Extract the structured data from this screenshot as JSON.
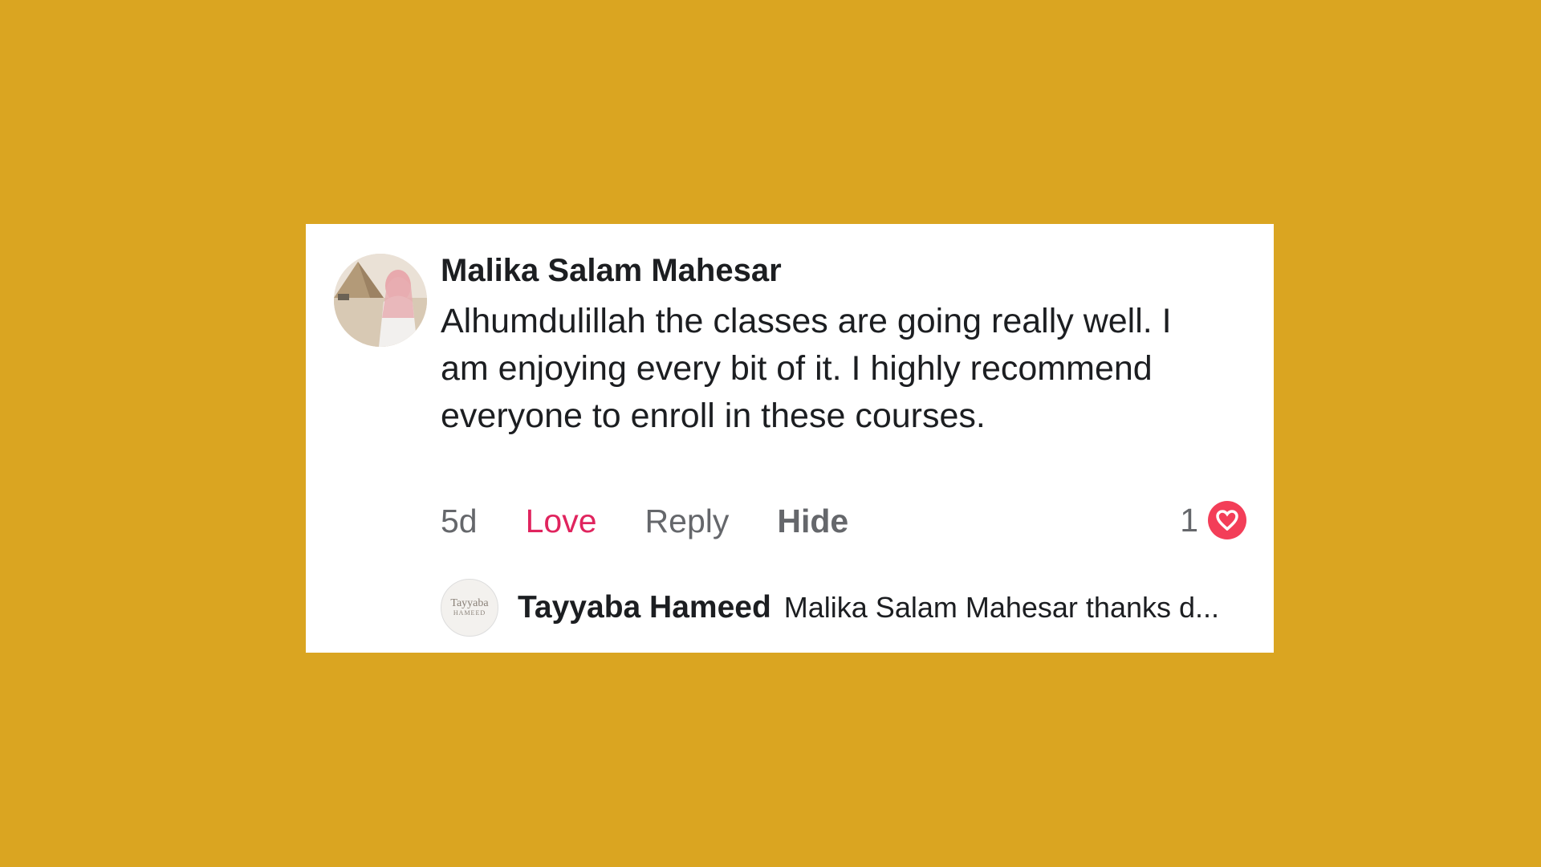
{
  "comment": {
    "author": "Malika Salam Mahesar",
    "text": "Alhumdulillah the classes are going really well. I am enjoying every bit of it. I highly recommend everyone to enroll in these courses.",
    "timestamp": "5d",
    "actions": {
      "love": "Love",
      "reply": "Reply",
      "hide": "Hide"
    },
    "reaction_count": "1",
    "reaction_type": "heart-icon",
    "colors": {
      "love": "#e0245e",
      "heart_badge": "#f33e58",
      "background": "#DAA521"
    }
  },
  "reply_preview": {
    "avatar_text_line1": "Tayyaba",
    "avatar_text_line2": "HAMEED",
    "author": "Tayyaba Hameed",
    "text": "Malika Salam Mahesar thanks d..."
  }
}
